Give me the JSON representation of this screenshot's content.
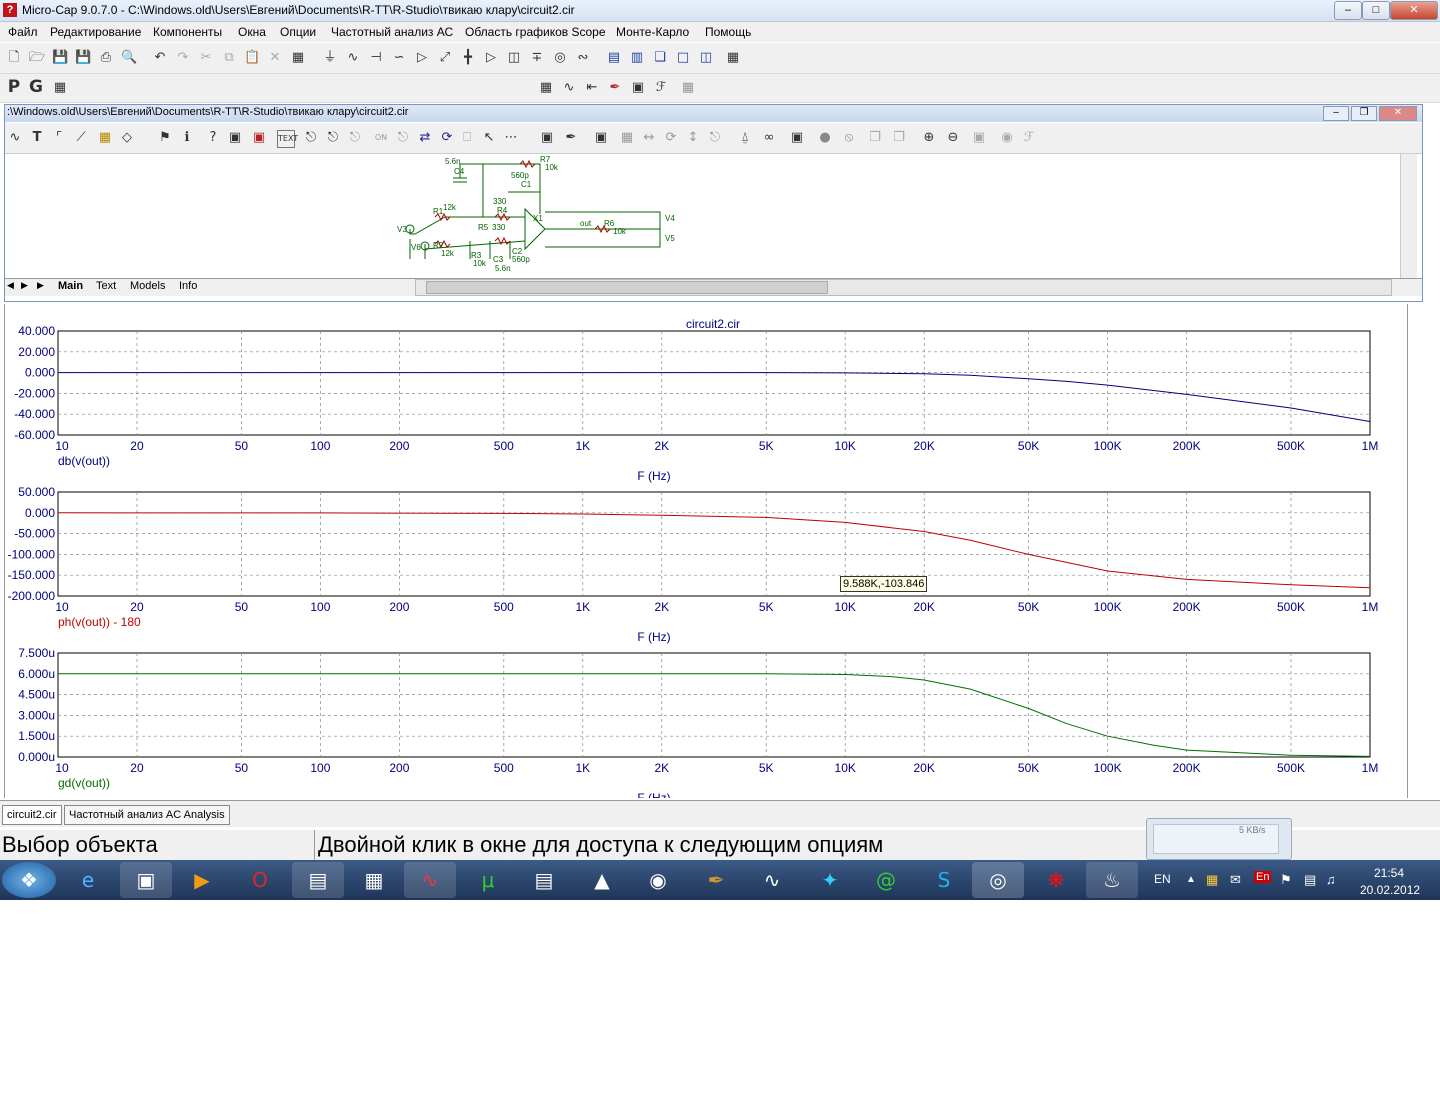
{
  "window": {
    "title": "Micro-Cap 9.0.7.0 - C:\\Windows.old\\Users\\Евгений\\Documents\\R-TT\\R-Studio\\твикаю клару\\circuit2.cir"
  },
  "menu": [
    "Файл",
    "Редактирование",
    "Компоненты",
    "Окна",
    "Опции",
    "Частотный анализ АС",
    "Область графиков Scope",
    "Монте-Карло",
    "Помощь"
  ],
  "toolbar2": {
    "p_label": "P",
    "g_label": "G"
  },
  "schematic": {
    "title": ":\\Windows.old\\Users\\Евгений\\Documents\\R-TT\\R-Studio\\твикаю клару\\circuit2.cir",
    "labels": [
      "5.6n",
      "C4",
      "R7",
      "10k",
      "560p",
      "C1",
      "R1",
      "12k",
      "330",
      "R4",
      "X1",
      "V3",
      "R5",
      "330",
      "out",
      "R6",
      "10k",
      "V4",
      "V6",
      "R2",
      "12k",
      "R3",
      "10k",
      "C3",
      "5.6n",
      "C2",
      "560p",
      "V5"
    ],
    "tabs": [
      "Main",
      "Text",
      "Models",
      "Info"
    ]
  },
  "plots": {
    "title": "circuit2.cir",
    "x_ticks": [
      "10",
      "20",
      "50",
      "100",
      "200",
      "500",
      "1K",
      "2K",
      "5K",
      "10K",
      "20K",
      "50K",
      "100K",
      "200K",
      "500K",
      "1M"
    ],
    "x_label": "F (Hz)",
    "panels": [
      {
        "y_ticks": [
          "40.000",
          "20.000",
          "0.000",
          "-20.000",
          "-40.000",
          "-60.000"
        ],
        "trace_label": "db(v(out))",
        "color": "#000080"
      },
      {
        "y_ticks": [
          "50.000",
          "0.000",
          "-50.000",
          "-100.000",
          "-150.000",
          "-200.000"
        ],
        "trace_label": "ph(v(out)) - 180",
        "color": "#c00000"
      },
      {
        "y_ticks": [
          "7.500u",
          "6.000u",
          "4.500u",
          "3.000u",
          "1.500u",
          "0.000u"
        ],
        "trace_label": "gd(v(out))",
        "color": "#007000"
      }
    ],
    "tooltip": "9.588K,-103.846"
  },
  "chart_data": [
    {
      "type": "line",
      "xscale": "log",
      "xlim": [
        10,
        1000000
      ],
      "ylim": [
        -60,
        40
      ],
      "xlabel": "F (Hz)",
      "series": [
        {
          "name": "db(v(out))",
          "x": [
            10,
            100,
            1000,
            5000,
            10000,
            20000,
            30000,
            50000,
            70000,
            100000,
            200000,
            500000,
            1000000
          ],
          "y": [
            0,
            0,
            0,
            0,
            -0.3,
            -1.2,
            -2.5,
            -6,
            -8.5,
            -12,
            -21,
            -34,
            -47
          ]
        }
      ]
    },
    {
      "type": "line",
      "xscale": "log",
      "xlim": [
        10,
        1000000
      ],
      "ylim": [
        -200,
        50
      ],
      "xlabel": "F (Hz)",
      "series": [
        {
          "name": "ph(v(out)) - 180",
          "x": [
            10,
            100,
            500,
            1000,
            2000,
            5000,
            10000,
            20000,
            30000,
            50000,
            100000,
            200000,
            500000,
            1000000
          ],
          "y": [
            0,
            -0.3,
            -1.5,
            -3,
            -6,
            -11,
            -23,
            -45,
            -66,
            -100,
            -140,
            -160,
            -173,
            -180
          ]
        }
      ]
    },
    {
      "type": "line",
      "xscale": "log",
      "xlim": [
        10,
        1000000
      ],
      "ylim": [
        0,
        7.5
      ],
      "xlabel": "F (Hz)",
      "series": [
        {
          "name": "gd(v(out))",
          "x": [
            10,
            1000,
            5000,
            10000,
            15000,
            20000,
            30000,
            50000,
            70000,
            100000,
            150000,
            200000,
            500000,
            1000000
          ],
          "y": [
            6.0,
            6.0,
            6.0,
            5.95,
            5.8,
            5.55,
            4.9,
            3.5,
            2.4,
            1.5,
            0.85,
            0.5,
            0.12,
            0.04
          ]
        }
      ]
    }
  ],
  "doc_tabs": [
    "circuit2.cir",
    "Частотный анализ AC Analysis"
  ],
  "status": {
    "left": "Выбор объекта",
    "right": "Двойной клик в окне для доступа к следующим опциям"
  },
  "netmeter": {
    "speed": "5 KB/s"
  },
  "tray": {
    "lang": "EN",
    "time": "21:54",
    "date": "20.02.2012"
  }
}
